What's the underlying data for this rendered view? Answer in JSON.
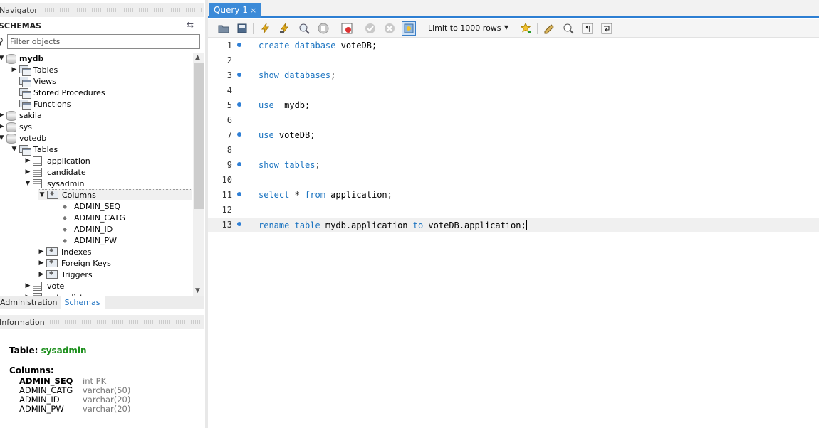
{
  "navigator": {
    "header": "Navigator",
    "schemas_title": "SCHEMAS",
    "filter_placeholder": "Filter objects",
    "tree": {
      "mydb": {
        "label": "mydb",
        "children": [
          "Tables",
          "Views",
          "Stored Procedures",
          "Functions"
        ]
      },
      "sakila": "sakila",
      "sys": "sys",
      "votedb": {
        "label": "votedb",
        "tables_label": "Tables",
        "tables": [
          "application",
          "candidate",
          "sysadmin"
        ],
        "columns_label": "Columns",
        "columns": [
          "ADMIN_SEQ",
          "ADMIN_CATG",
          "ADMIN_ID",
          "ADMIN_PW"
        ],
        "subfolders": [
          "Indexes",
          "Foreign Keys",
          "Triggers"
        ],
        "more_tables": [
          "vote",
          "voter_list"
        ]
      }
    },
    "tabs": [
      "Administration",
      "Schemas"
    ]
  },
  "information": {
    "header": "Information",
    "table_prefix": "Table:",
    "table_name": "sysadmin",
    "columns_label": "Columns:",
    "columns": [
      {
        "name": "ADMIN_SEQ",
        "type": "int PK"
      },
      {
        "name": "ADMIN_CATG",
        "type": "varchar(50)"
      },
      {
        "name": "ADMIN_ID",
        "type": "varchar(20)"
      },
      {
        "name": "ADMIN_PW",
        "type": "varchar(20)"
      }
    ]
  },
  "query_tab": {
    "label": "Query 1",
    "close": "×"
  },
  "toolbar": {
    "limit_label": "Limit to 1000 rows",
    "icons": [
      "open-file-icon",
      "save-icon",
      "execute-icon",
      "execute-current-icon",
      "explain-icon",
      "stop-icon",
      "toggle-error-icon",
      "commit-icon",
      "rollback-icon",
      "autocommit-icon",
      "bookmark-icon",
      "beautify-icon",
      "find-icon",
      "invisible-chars-icon",
      "wrap-icon"
    ]
  },
  "editor": {
    "lines": [
      {
        "n": "1",
        "code": [
          [
            "kw",
            "create database"
          ],
          [
            "t",
            " voteDB;"
          ]
        ]
      },
      {
        "n": "2",
        "code": []
      },
      {
        "n": "3",
        "code": [
          [
            "kw",
            "show databases"
          ],
          [
            "t",
            ";"
          ]
        ]
      },
      {
        "n": "4",
        "code": []
      },
      {
        "n": "5",
        "code": [
          [
            "kw",
            "use"
          ],
          [
            "t",
            "  mydb;"
          ]
        ]
      },
      {
        "n": "6",
        "code": []
      },
      {
        "n": "7",
        "code": [
          [
            "kw",
            "use"
          ],
          [
            "t",
            " voteDB;"
          ]
        ]
      },
      {
        "n": "8",
        "code": []
      },
      {
        "n": "9",
        "code": [
          [
            "kw",
            "show tables"
          ],
          [
            "t",
            ";"
          ]
        ]
      },
      {
        "n": "10",
        "code": []
      },
      {
        "n": "11",
        "code": [
          [
            "kw",
            "select"
          ],
          [
            "t",
            " * "
          ],
          [
            "kw",
            "from"
          ],
          [
            "t",
            " application;"
          ]
        ]
      },
      {
        "n": "12",
        "code": []
      },
      {
        "n": "13",
        "code": [
          [
            "kw",
            "rename table"
          ],
          [
            "t",
            " mydb.application "
          ],
          [
            "kw",
            "to"
          ],
          [
            "t",
            " voteDB.application;"
          ]
        ]
      }
    ]
  },
  "colors": {
    "accent": "#2d7fd3",
    "keyword": "#1a73c0",
    "table_name": "#1d8f1d"
  }
}
